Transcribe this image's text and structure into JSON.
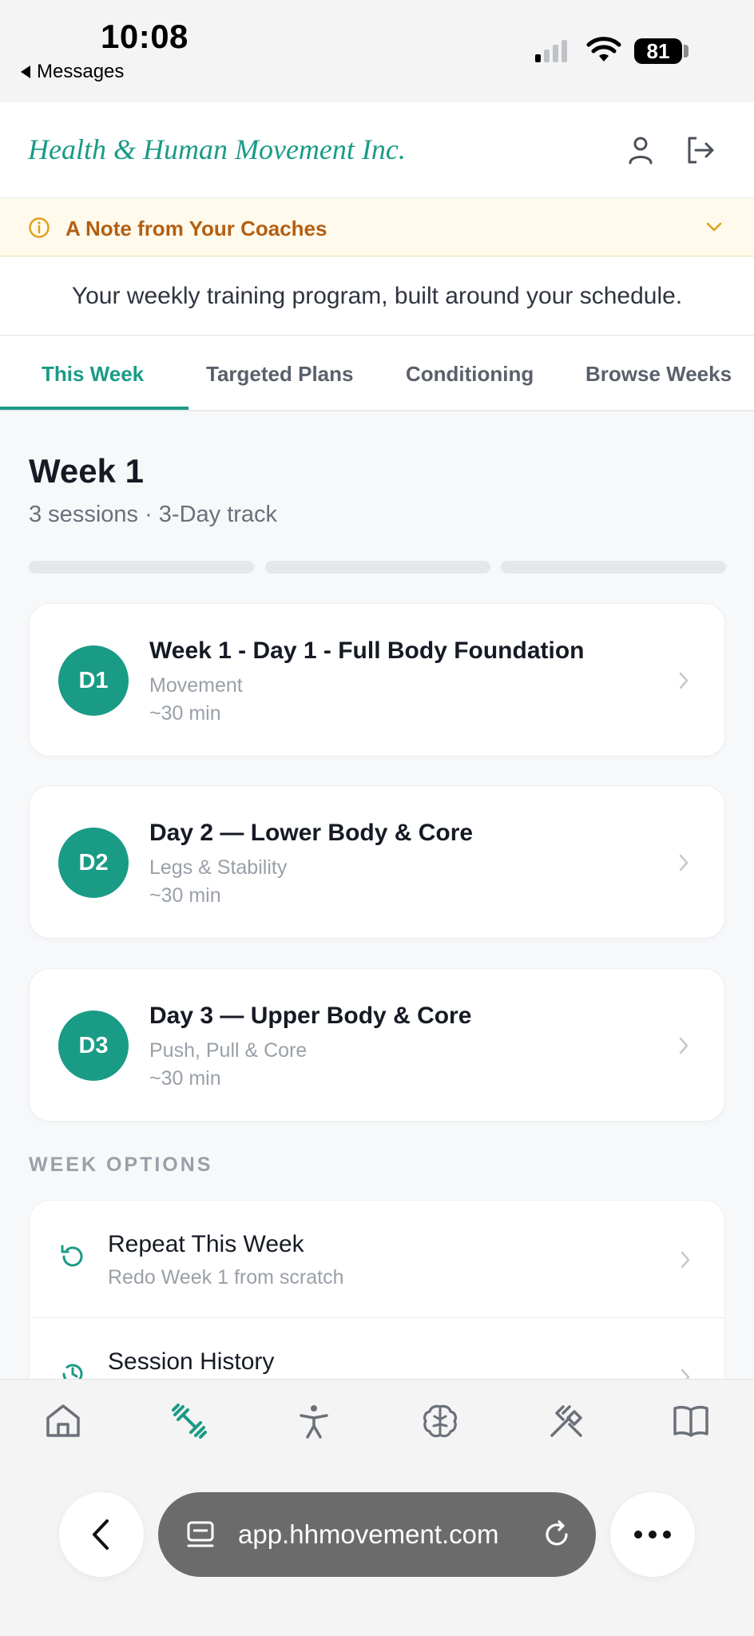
{
  "status_bar": {
    "time": "10:08",
    "back_app": "Messages",
    "battery": "81",
    "icons": [
      "signal-icon",
      "wifi-icon",
      "battery-icon"
    ]
  },
  "header": {
    "brand": "Health & Human Movement Inc.",
    "icons": [
      "user-icon",
      "logout-icon"
    ]
  },
  "coach_note": {
    "label": "A Note from Your Coaches",
    "icons": [
      "info-icon",
      "chevron-down-icon"
    ],
    "color": "#b35f13"
  },
  "tagline": "Your weekly training program, built around your schedule.",
  "tabs": [
    {
      "label": "This Week",
      "active": true
    },
    {
      "label": "Targeted Plans"
    },
    {
      "label": "Conditioning"
    },
    {
      "label": "Browse Weeks"
    }
  ],
  "week": {
    "title": "Week 1",
    "subtitle": "3 sessions · 3-Day track",
    "progress_completed": 0,
    "progress_total": 3
  },
  "sessions": [
    {
      "badge": "D1",
      "title": "Week 1 - Day 1 - Full Body Foundation",
      "subtitle": "Movement",
      "duration": "~30 min"
    },
    {
      "badge": "D2",
      "title": "Day 2 — Lower Body & Core",
      "subtitle": "Legs & Stability",
      "duration": "~30 min"
    },
    {
      "badge": "D3",
      "title": "Day 3 — Upper Body & Core",
      "subtitle": "Push, Pull & Core",
      "duration": "~30 min"
    }
  ],
  "week_options": {
    "label": "WEEK OPTIONS",
    "items": [
      {
        "title": "Repeat This Week",
        "subtitle": "Redo Week 1 from scratch",
        "icon": "repeat-icon"
      },
      {
        "title": "Session History",
        "subtitle": "",
        "icon": "history-icon"
      }
    ]
  },
  "bottom_nav": {
    "items": [
      "home-icon",
      "dumbbell-icon",
      "person-icon",
      "brain-icon",
      "fork-knife-icon",
      "book-icon"
    ],
    "active": "dumbbell-icon"
  },
  "browser": {
    "url": "app.hhmovement.com",
    "icons": [
      "back-icon",
      "tab-icon",
      "reload-icon",
      "more-icon"
    ]
  },
  "colors": {
    "accent": "#1a9b86",
    "note_bg": "#fffaeb"
  }
}
